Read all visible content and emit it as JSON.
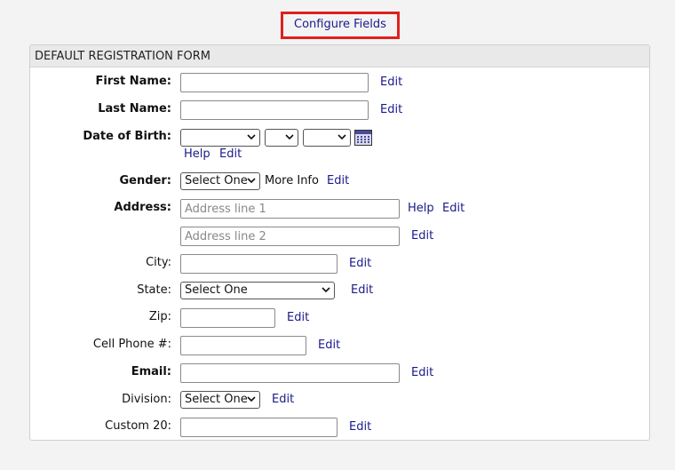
{
  "configure_fields": "Configure Fields",
  "form_title": "DEFAULT REGISTRATION FORM",
  "edit": "Edit",
  "help": "Help",
  "fields": {
    "first_name": "First Name:",
    "last_name": "Last Name:",
    "dob": "Date of Birth:",
    "gender": "Gender:",
    "gender_select": "Select One",
    "more_info": "More Info",
    "address": "Address:",
    "address1_placeholder": "Address line 1",
    "address2_placeholder": "Address line 2",
    "city": "City:",
    "state": "State:",
    "state_select": "Select One",
    "zip": "Zip:",
    "cell": "Cell Phone #:",
    "email": "Email:",
    "division": "Division:",
    "division_select": "Select One",
    "custom20": "Custom 20:"
  },
  "icons": {
    "calendar": "calendar-icon",
    "chevron": "chevron-down-icon"
  }
}
